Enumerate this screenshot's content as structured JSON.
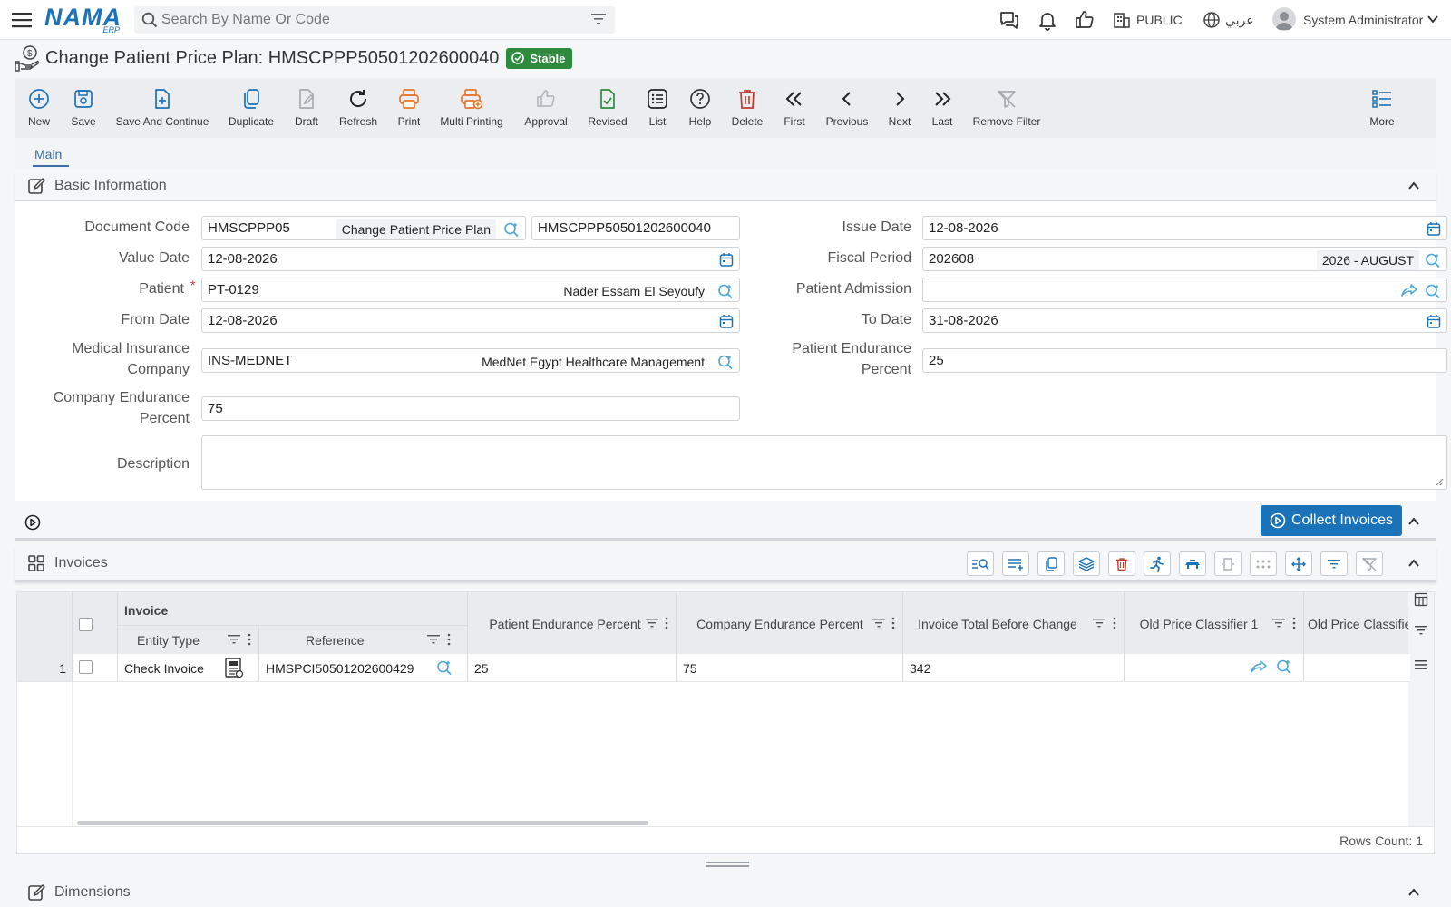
{
  "topbar": {
    "logo_main": "NAMA",
    "logo_sub": "ERP",
    "search_placeholder": "Search By Name Or Code",
    "public_label": "PUBLIC",
    "language_label": "عربي",
    "user_name": "System Administrator"
  },
  "page": {
    "title": "Change Patient Price Plan: HMSCPPP50501202600040",
    "status": "Stable"
  },
  "toolbar": {
    "new": "New",
    "save": "Save",
    "save_continue": "Save And Continue",
    "duplicate": "Duplicate",
    "draft": "Draft",
    "refresh": "Refresh",
    "print": "Print",
    "multi_printing": "Multi Printing",
    "approval": "Approval",
    "revised": "Revised",
    "list": "List",
    "help": "Help",
    "delete": "Delete",
    "first": "First",
    "previous": "Previous",
    "next": "Next",
    "last": "Last",
    "remove_filter": "Remove Filter",
    "more": "More"
  },
  "tabs": {
    "main": "Main"
  },
  "basic": {
    "section_title": "Basic Information",
    "document_code_label": "Document Code",
    "document_code": "HMSCPPP05",
    "document_type": "Change Patient Price Plan",
    "document_number": "HMSCPPP50501202600040",
    "issue_date_label": "Issue Date",
    "issue_date": "12-08-2026",
    "value_date_label": "Value Date",
    "value_date": "12-08-2026",
    "fiscal_period_label": "Fiscal Period",
    "fiscal_period": "202608",
    "fiscal_period_name": "2026 - AUGUST",
    "patient_label": "Patient",
    "required_mark": "*",
    "patient_code": "PT-0129",
    "patient_name": "Nader Essam El Seyoufy",
    "patient_admission_label": "Patient Admission",
    "patient_admission": "",
    "from_date_label": "From Date",
    "from_date": "12-08-2026",
    "to_date_label": "To Date",
    "to_date": "31-08-2026",
    "medical_insurance_label_1": "Medical Insurance",
    "medical_insurance_label_2": "Company",
    "insurance_code": "INS-MEDNET",
    "insurance_name": "MedNet Egypt Healthcare Management",
    "patient_endurance_label_1": "Patient Endurance",
    "patient_endurance_label_2": "Percent",
    "patient_endurance": "25",
    "company_endurance_label_1": "Company Endurance",
    "company_endurance_label_2": "Percent",
    "company_endurance": "75",
    "description_label": "Description",
    "description": ""
  },
  "collect": {
    "button": "Collect Invoices"
  },
  "invoices": {
    "section_title": "Invoices",
    "group_header": "Invoice",
    "columns": {
      "entity_type": "Entity Type",
      "reference": "Reference",
      "patient_endurance": "Patient Endurance Percent",
      "company_endurance": "Company Endurance Percent",
      "total_before": "Invoice Total Before Change",
      "old_price_1": "Old Price Classifier 1",
      "old_price_2": "Old Price Classifie"
    },
    "rows": [
      {
        "num": "1",
        "entity_type": "Check Invoice",
        "reference": "HMSPCI50501202600429",
        "patient_endurance": "25",
        "company_endurance": "75",
        "total_before": "342",
        "old_price_1": ""
      }
    ],
    "rows_count": "Rows Count: 1"
  },
  "dimensions": {
    "section_title": "Dimensions"
  },
  "colors": {
    "accent": "#1a72b8",
    "stable": "#2e8b3e",
    "danger": "#c0392b",
    "orange": "#e8762c"
  }
}
